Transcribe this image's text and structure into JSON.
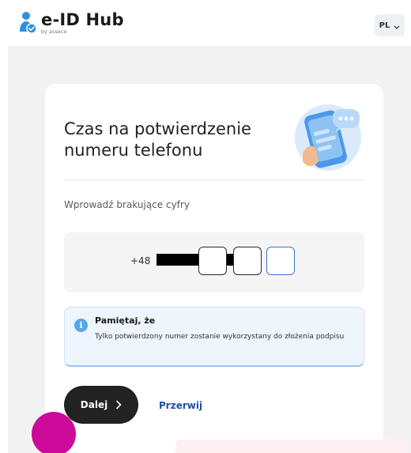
{
  "header": {
    "logo_title": "e-ID Hub",
    "logo_by": "by asseco",
    "language": "PL"
  },
  "card": {
    "title": "Czas na potwierdzenie numeru telefonu",
    "hint": "Wprowadź brakujące cyfry",
    "phone": {
      "prefix": "+48",
      "digits": [
        "",
        "",
        ""
      ]
    },
    "notice": {
      "title": "Pamiętaj, że",
      "body": "Tylko potwierdzony numer zostanie wykorzystany do złożenia podpisu"
    },
    "next_label": "Dalej",
    "cancel_label": "Przerwij"
  },
  "colors": {
    "accent": "#3f74c9",
    "link": "#1f4fa8",
    "info": "#58a6ec",
    "chat": "#cc0a9a"
  }
}
